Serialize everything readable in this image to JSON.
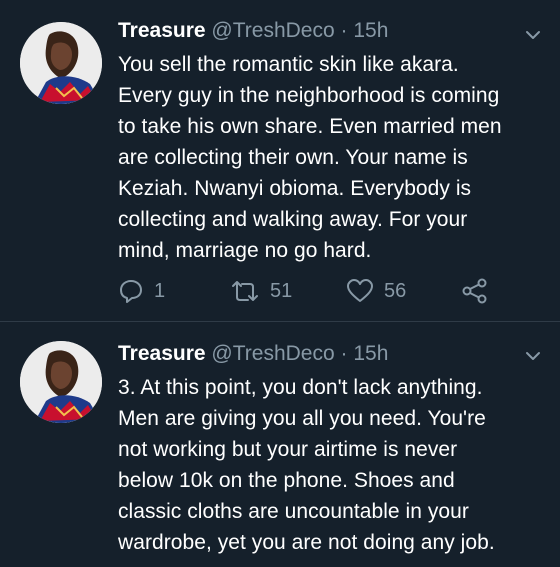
{
  "tweets": [
    {
      "name": "Treasure",
      "handle": "@TreshDeco",
      "separator": "·",
      "time": "15h",
      "lines": [
        "You sell the romantic skin like akara.",
        "Every guy in the neighborhood is coming",
        "to take his own share. Even married men",
        "are collecting their own. Your name is",
        "Keziah. Nwanyi obioma. Everybody is",
        "collecting and walking away. For your",
        "mind, marriage no go hard."
      ],
      "replies": "1",
      "retweets": "51",
      "likes": "56"
    },
    {
      "name": "Treasure",
      "handle": "@TreshDeco",
      "separator": "·",
      "time": "15h",
      "lines": [
        "3. At this point, you don't lack anything.",
        "Men are giving you all you need. You're",
        "not working but your airtime is never",
        "below 10k on the phone. Shoes and",
        "classic cloths are uncountable in your",
        "wardrobe, yet you are not doing any job."
      ]
    }
  ],
  "icons": {
    "reply": "reply-icon",
    "retweet": "retweet-icon",
    "like": "heart-icon",
    "share": "share-icon",
    "menu": "chevron-down-icon"
  },
  "colors": {
    "background": "#15202b",
    "text": "#ffffff",
    "secondary": "#8899a6",
    "divider": "#2f3b47"
  }
}
